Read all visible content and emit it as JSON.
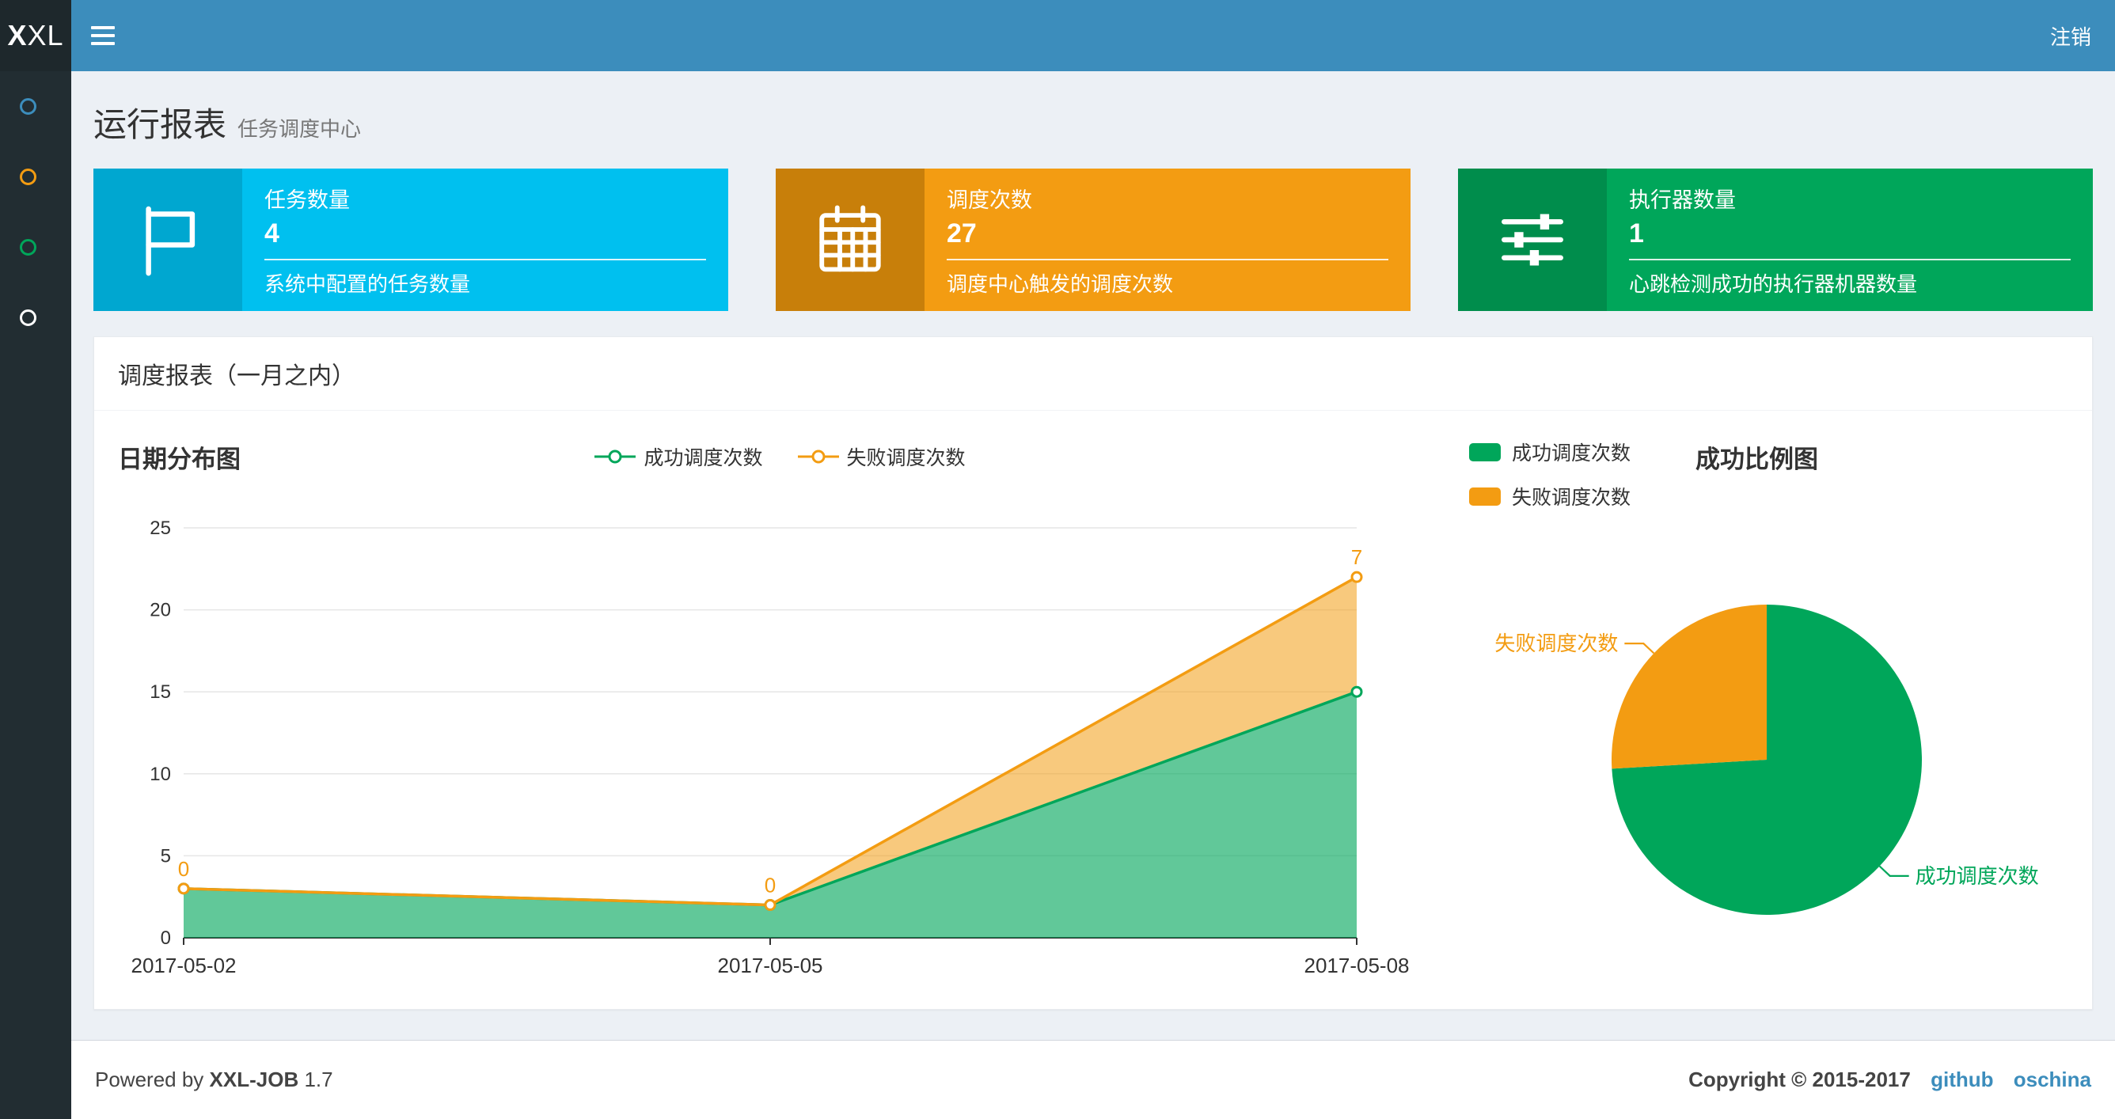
{
  "colors": {
    "navbar": "#3c8dbc",
    "logo_bg": "#1e282c",
    "sidebar_bg": "#222d32",
    "page_bg": "#ecf0f5",
    "link": "#3c8dbc"
  },
  "navbar": {
    "logo_bold": "X",
    "logo_rest": "XL",
    "logout_label": "注销"
  },
  "sidebar": {
    "items": [
      {
        "icon": "circle-icon",
        "color": "#3c8dbc"
      },
      {
        "icon": "circle-icon",
        "color": "#f39c12"
      },
      {
        "icon": "circle-icon",
        "color": "#00a65a"
      },
      {
        "icon": "circle-icon",
        "color": "#ffffff"
      }
    ]
  },
  "page_header": {
    "title": "运行报表",
    "subtitle": "任务调度中心"
  },
  "info_boxes": [
    {
      "title": "任务数量",
      "value": "4",
      "desc": "系统中配置的任务数量",
      "bg": "#00c0ef",
      "icon_bg": "#00a7d0",
      "icon": "flag-icon"
    },
    {
      "title": "调度次数",
      "value": "27",
      "desc": "调度中心触发的调度次数",
      "bg": "#f39c12",
      "icon_bg": "#c87f0a",
      "icon": "calendar-icon"
    },
    {
      "title": "执行器数量",
      "value": "1",
      "desc": "心跳检测成功的执行器机器数量",
      "bg": "#00a65a",
      "icon_bg": "#008d4c",
      "icon": "sliders-icon"
    }
  ],
  "panel": {
    "title": "调度报表（一月之内）"
  },
  "chart_data": [
    {
      "type": "area",
      "title": "日期分布图",
      "x": [
        "2017-05-02",
        "2017-05-05",
        "2017-05-08"
      ],
      "series": [
        {
          "name": "成功调度次数",
          "values": [
            3,
            2,
            15
          ],
          "color": "#00a65a",
          "fill_opacity": 0.62
        },
        {
          "name": "失败调度次数",
          "values": [
            0,
            0,
            7
          ],
          "color": "#f39c12",
          "fill_opacity": 0.55,
          "stacked_on_previous": true,
          "point_labels": [
            "0",
            "0",
            "7"
          ]
        }
      ],
      "stacked": true,
      "ylim": [
        0,
        25
      ],
      "y_ticks": [
        0,
        5,
        10,
        15,
        20,
        25
      ],
      "grid": true,
      "legend_position": "top-center"
    },
    {
      "type": "pie",
      "title": "成功比例图",
      "slices": [
        {
          "name": "成功调度次数",
          "value": 20,
          "color": "#00a65a"
        },
        {
          "name": "失败调度次数",
          "value": 7,
          "color": "#f39c12"
        }
      ],
      "total": 27,
      "legend_position": "top-left",
      "start_angle": 90,
      "clockwise": true
    }
  ],
  "footer": {
    "powered_by": "Powered by",
    "brand": "XXL-JOB",
    "version": "1.7",
    "copyright": "Copyright © 2015-2017",
    "links": [
      {
        "label": "github"
      },
      {
        "label": "oschina"
      }
    ]
  }
}
